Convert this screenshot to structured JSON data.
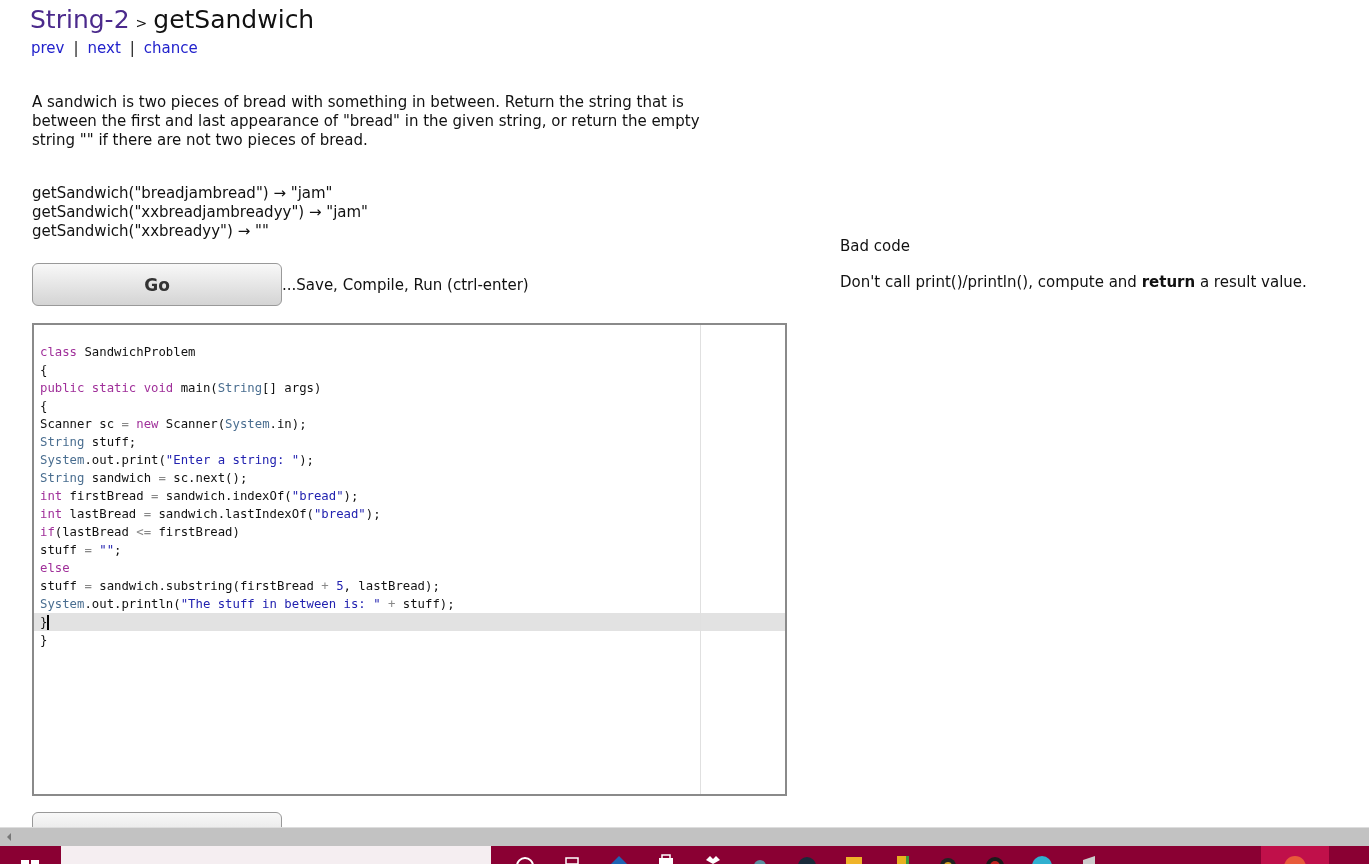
{
  "breadcrumb": {
    "section": "String-2",
    "separator": ">",
    "title": "getSandwich"
  },
  "nav": [
    {
      "label": "prev"
    },
    {
      "label": "next"
    },
    {
      "label": "chance"
    }
  ],
  "nav_separator": "|",
  "description": "A sandwich is two pieces of bread with something in between. Return the string that is between the first and last appearance of \"bread\" in the given string, or return the empty string \"\" if there are not two pieces of bread.",
  "examples": [
    "getSandwich(\"breadjambread\") → \"jam\"",
    "getSandwich(\"xxbreadjambreadyy\") → \"jam\"",
    "getSandwich(\"xxbreadyy\") → \"\""
  ],
  "go_button": "Go",
  "go_hint": "...Save, Compile, Run (ctrl-enter)",
  "feedback": {
    "title": "Bad code",
    "message": "Don't call print()/println(), compute and **return** a result value."
  },
  "code": [
    {
      "active": false,
      "tokens": [
        {
          "kind": "kw",
          "text": "class"
        },
        {
          "kind": "plain",
          "text": " SandwichProblem"
        }
      ]
    },
    {
      "active": false,
      "tokens": [
        {
          "kind": "plain",
          "text": "{"
        }
      ]
    },
    {
      "active": false,
      "tokens": [
        {
          "kind": "kw",
          "text": "public static void"
        },
        {
          "kind": "plain",
          "text": " main("
        },
        {
          "kind": "type",
          "text": "String"
        },
        {
          "kind": "plain",
          "text": "[] args)"
        }
      ]
    },
    {
      "active": false,
      "tokens": [
        {
          "kind": "plain",
          "text": "{"
        }
      ]
    },
    {
      "active": false,
      "tokens": [
        {
          "kind": "plain",
          "text": "Scanner sc "
        },
        {
          "kind": "op",
          "text": "= "
        },
        {
          "kind": "kw",
          "text": "new"
        },
        {
          "kind": "plain",
          "text": " Scanner("
        },
        {
          "kind": "type",
          "text": "System"
        },
        {
          "kind": "plain",
          "text": ".in);"
        }
      ]
    },
    {
      "active": false,
      "tokens": [
        {
          "kind": "type",
          "text": "String"
        },
        {
          "kind": "plain",
          "text": " stuff;"
        }
      ]
    },
    {
      "active": false,
      "tokens": [
        {
          "kind": "type",
          "text": "System"
        },
        {
          "kind": "plain",
          "text": ".out.print("
        },
        {
          "kind": "str",
          "text": "\"Enter a string: \""
        },
        {
          "kind": "plain",
          "text": ");"
        }
      ]
    },
    {
      "active": false,
      "tokens": [
        {
          "kind": "type",
          "text": "String"
        },
        {
          "kind": "plain",
          "text": " sandwich "
        },
        {
          "kind": "op",
          "text": "="
        },
        {
          "kind": "plain",
          "text": " sc.next();"
        }
      ]
    },
    {
      "active": false,
      "tokens": [
        {
          "kind": "kw",
          "text": "int"
        },
        {
          "kind": "plain",
          "text": " firstBread "
        },
        {
          "kind": "op",
          "text": "="
        },
        {
          "kind": "plain",
          "text": " sandwich.indexOf("
        },
        {
          "kind": "str",
          "text": "\"bread\""
        },
        {
          "kind": "plain",
          "text": ");"
        }
      ]
    },
    {
      "active": false,
      "tokens": [
        {
          "kind": "kw",
          "text": "int"
        },
        {
          "kind": "plain",
          "text": " lastBread "
        },
        {
          "kind": "op",
          "text": "="
        },
        {
          "kind": "plain",
          "text": " sandwich.lastIndexOf("
        },
        {
          "kind": "str",
          "text": "\"bread\""
        },
        {
          "kind": "plain",
          "text": ");"
        }
      ]
    },
    {
      "active": false,
      "tokens": [
        {
          "kind": "kw",
          "text": "if"
        },
        {
          "kind": "plain",
          "text": "(lastBread "
        },
        {
          "kind": "op",
          "text": "<="
        },
        {
          "kind": "plain",
          "text": " firstBread)"
        }
      ]
    },
    {
      "active": false,
      "tokens": [
        {
          "kind": "plain",
          "text": "stuff "
        },
        {
          "kind": "op",
          "text": "= "
        },
        {
          "kind": "str",
          "text": "\"\""
        },
        {
          "kind": "plain",
          "text": ";"
        }
      ]
    },
    {
      "active": false,
      "tokens": [
        {
          "kind": "kw",
          "text": "else"
        }
      ]
    },
    {
      "active": false,
      "tokens": [
        {
          "kind": "plain",
          "text": "stuff "
        },
        {
          "kind": "op",
          "text": "="
        },
        {
          "kind": "plain",
          "text": " sandwich.substring(firstBread "
        },
        {
          "kind": "op",
          "text": "+ "
        },
        {
          "kind": "num",
          "text": "5"
        },
        {
          "kind": "plain",
          "text": ", lastBread);"
        }
      ]
    },
    {
      "active": false,
      "tokens": [
        {
          "kind": "type",
          "text": "System"
        },
        {
          "kind": "plain",
          "text": ".out.println("
        },
        {
          "kind": "str",
          "text": "\"The stuff in between is: \""
        },
        {
          "kind": "op",
          "text": " +"
        },
        {
          "kind": "plain",
          "text": " stuff);"
        }
      ]
    },
    {
      "active": true,
      "tokens": [
        {
          "kind": "plain",
          "text": "}"
        }
      ]
    },
    {
      "active": false,
      "tokens": [
        {
          "kind": "plain",
          "text": "}"
        }
      ]
    }
  ]
}
